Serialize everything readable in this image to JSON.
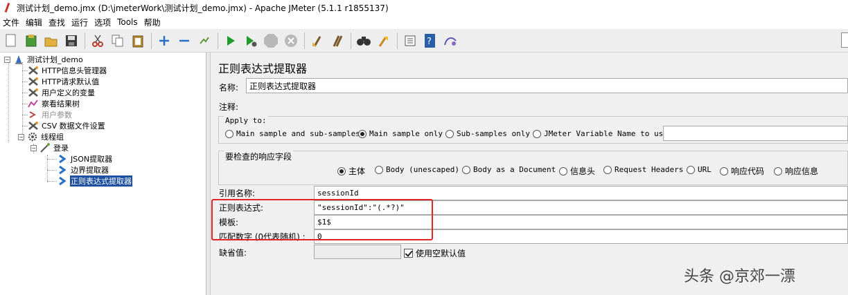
{
  "window": {
    "title": "测试计划_demo.jmx (D:\\jmeterWork\\测试计划_demo.jmx) - Apache JMeter (5.1.1 r1855137)"
  },
  "menu": [
    "文件",
    "编辑",
    "查找",
    "运行",
    "选项",
    "Tools",
    "帮助"
  ],
  "toolbar": [
    "new-icon",
    "templates-icon",
    "open-icon",
    "save-icon",
    "cut-icon",
    "copy-icon",
    "paste-icon",
    "expand-icon",
    "collapse-icon",
    "toggle-icon",
    "start-icon",
    "start-no-pause-icon",
    "stop-icon",
    "shutdown-icon",
    "clear-icon",
    "clear-all-icon",
    "search-icon",
    "reset-search-icon",
    "function-helper-icon",
    "help-icon",
    "remote-icon"
  ],
  "tree": {
    "root": "测试计划_demo",
    "items": [
      "HTTP信息头管理器",
      "HTTP请求默认值",
      "用户定义的变量",
      "察看结果树",
      "用户参数",
      "CSV 数据文件设置",
      "线程组",
      "登录",
      "JSON提取器",
      "边界提取器",
      "正则表达式提取器"
    ]
  },
  "panel": {
    "title": "正则表达式提取器",
    "name_label": "名称:",
    "name_value": "正则表达式提取器",
    "comment_label": "注释:",
    "comment_value": "",
    "apply_to": {
      "title": "Apply to:",
      "options": [
        "Main sample and sub-samples",
        "Main sample only",
        "Sub-samples only",
        "JMeter Variable Name to use"
      ],
      "selected": "Main sample only",
      "variable_value": ""
    },
    "field_to_check": {
      "title": "要检查的响应字段",
      "options": [
        "主体",
        "Body (unescaped)",
        "Body as a Document",
        "信息头",
        "Request Headers",
        "URL",
        "响应代码",
        "响应信息"
      ],
      "selected": "主体"
    },
    "ref_name_label": "引用名称:",
    "ref_name_value": "sessionId",
    "regex_label": "正则表达式:",
    "regex_value": "\"sessionId\":\"(.*?)\"",
    "template_label": "模板:",
    "template_value": "$1$",
    "match_no_label": "匹配数字 (0代表随机) :",
    "match_no_value": "0",
    "default_label": "缺省值:",
    "default_value": "",
    "use_empty_default_label": "使用空默认值",
    "use_empty_default_checked": true
  },
  "watermark": "头条 @京郊一漂"
}
